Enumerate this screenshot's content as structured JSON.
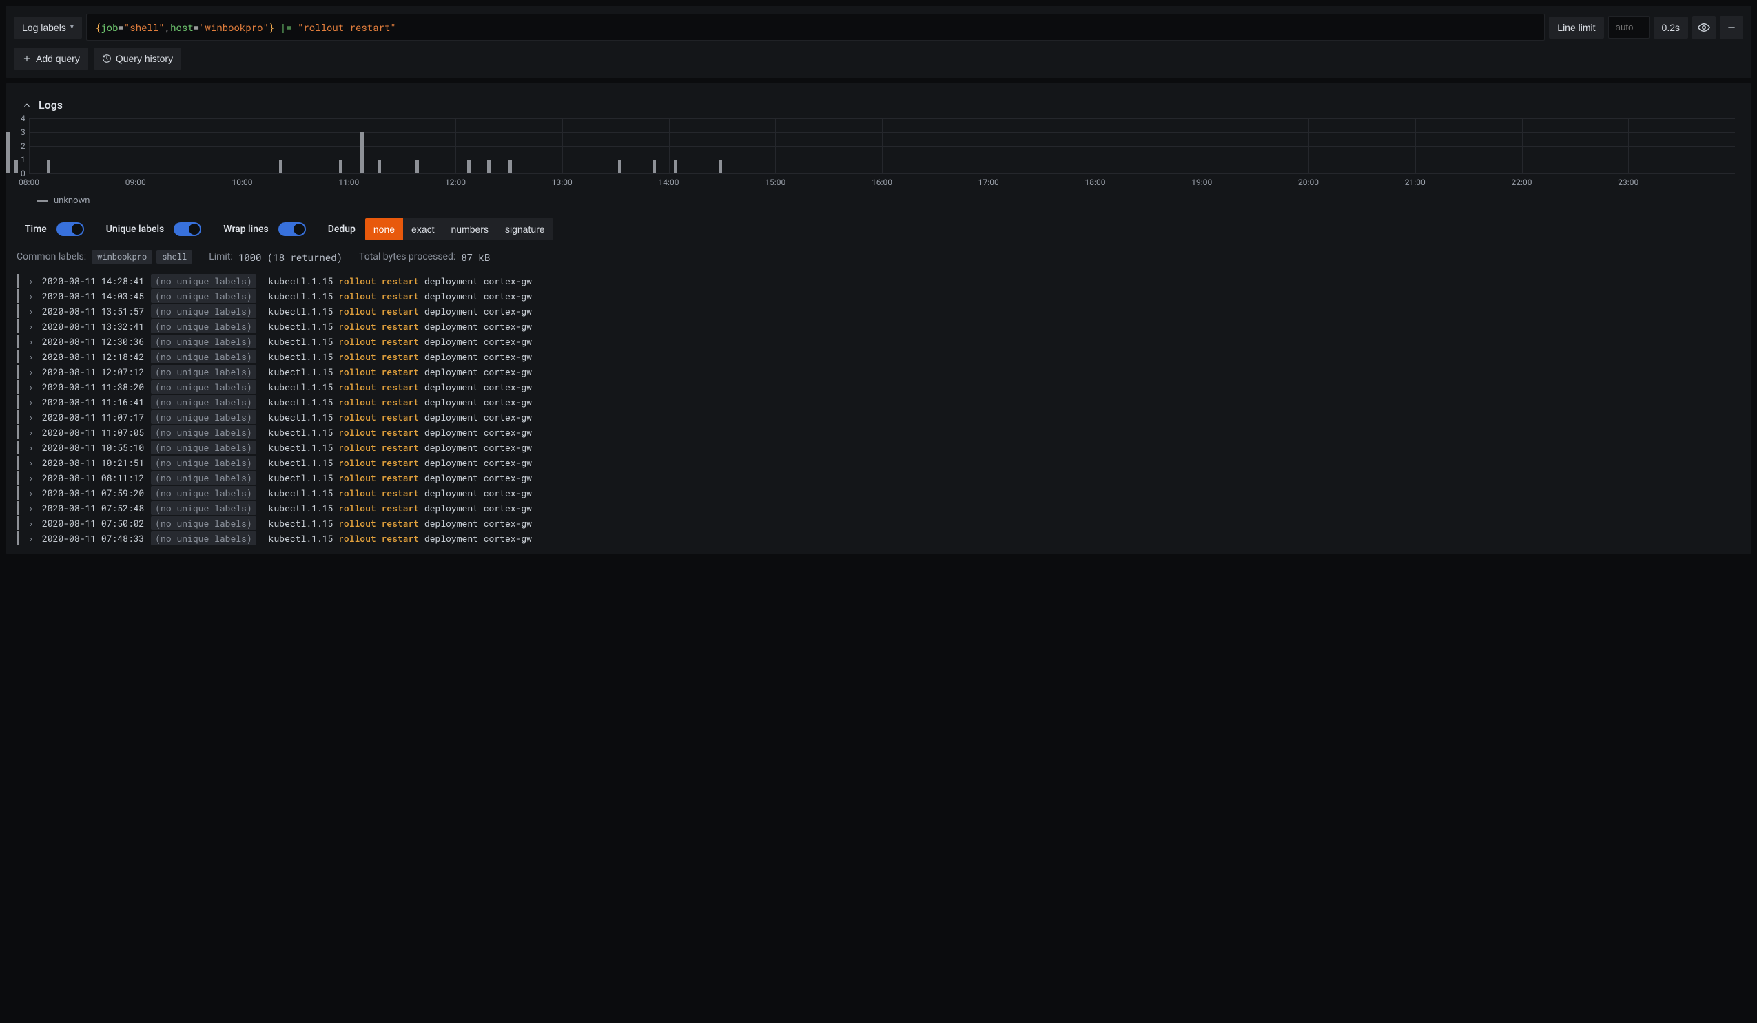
{
  "query_editor": {
    "log_labels_btn": "Log labels",
    "tokens": {
      "lbrace": "{",
      "k1": "job",
      "eq": "=",
      "v1": "\"shell\"",
      "comma": ",",
      "k2": "host",
      "v2": "\"winbookpro\"",
      "rbrace": "}",
      "space": " ",
      "pipe": "|=",
      "lit": "\"rollout restart\""
    },
    "line_limit_btn": "Line limit",
    "auto_placeholder": "auto",
    "elapsed": "0.2s",
    "add_query_btn": "Add query",
    "query_history_btn": "Query history"
  },
  "logs_section": {
    "title": "Logs",
    "legend": "unknown"
  },
  "options": {
    "time": "Time",
    "unique_labels": "Unique labels",
    "wrap_lines": "Wrap lines",
    "dedup": "Dedup",
    "dedup_modes": [
      "none",
      "exact",
      "numbers",
      "signature"
    ],
    "dedup_active": "none"
  },
  "meta": {
    "common_labels_label": "Common labels:",
    "common_labels": [
      "winbookpro",
      "shell"
    ],
    "limit_label": "Limit:",
    "limit_value": "1000 (18 returned)",
    "bytes_label": "Total bytes processed:",
    "bytes_value": "87 kB"
  },
  "log_template": {
    "no_unique": "(no unique labels)",
    "prefix": "kubectl.1.15 ",
    "highlight": "rollout restart",
    "suffix": " deployment cortex-gw"
  },
  "log_rows": [
    {
      "ts": "2020-08-11 14:28:41"
    },
    {
      "ts": "2020-08-11 14:03:45"
    },
    {
      "ts": "2020-08-11 13:51:57"
    },
    {
      "ts": "2020-08-11 13:32:41"
    },
    {
      "ts": "2020-08-11 12:30:36"
    },
    {
      "ts": "2020-08-11 12:18:42"
    },
    {
      "ts": "2020-08-11 12:07:12"
    },
    {
      "ts": "2020-08-11 11:38:20"
    },
    {
      "ts": "2020-08-11 11:16:41"
    },
    {
      "ts": "2020-08-11 11:07:17"
    },
    {
      "ts": "2020-08-11 11:07:05"
    },
    {
      "ts": "2020-08-11 10:55:10"
    },
    {
      "ts": "2020-08-11 10:21:51"
    },
    {
      "ts": "2020-08-11 08:11:12"
    },
    {
      "ts": "2020-08-11 07:59:20"
    },
    {
      "ts": "2020-08-11 07:52:48"
    },
    {
      "ts": "2020-08-11 07:50:02"
    },
    {
      "ts": "2020-08-11 07:48:33"
    }
  ],
  "chart_data": {
    "type": "bar",
    "xlabel": "",
    "ylabel": "",
    "x_start_hour": 8,
    "x_end_hour": 24,
    "ylim": [
      0,
      4
    ],
    "y_ticks": [
      0,
      1,
      2,
      3,
      4
    ],
    "x_ticks": [
      "08:00",
      "09:00",
      "10:00",
      "11:00",
      "12:00",
      "13:00",
      "14:00",
      "15:00",
      "16:00",
      "17:00",
      "18:00",
      "19:00",
      "20:00",
      "21:00",
      "22:00",
      "23:00"
    ],
    "bars": [
      {
        "hour_frac": 7.8,
        "count": 3
      },
      {
        "hour_frac": 7.88,
        "count": 1
      },
      {
        "hour_frac": 8.18,
        "count": 1
      },
      {
        "hour_frac": 10.36,
        "count": 1
      },
      {
        "hour_frac": 10.92,
        "count": 1
      },
      {
        "hour_frac": 11.12,
        "count": 3
      },
      {
        "hour_frac": 11.28,
        "count": 1
      },
      {
        "hour_frac": 11.64,
        "count": 1
      },
      {
        "hour_frac": 12.12,
        "count": 1
      },
      {
        "hour_frac": 12.31,
        "count": 1
      },
      {
        "hour_frac": 12.51,
        "count": 1
      },
      {
        "hour_frac": 13.54,
        "count": 1
      },
      {
        "hour_frac": 13.86,
        "count": 1
      },
      {
        "hour_frac": 14.06,
        "count": 1
      },
      {
        "hour_frac": 14.48,
        "count": 1
      }
    ]
  }
}
